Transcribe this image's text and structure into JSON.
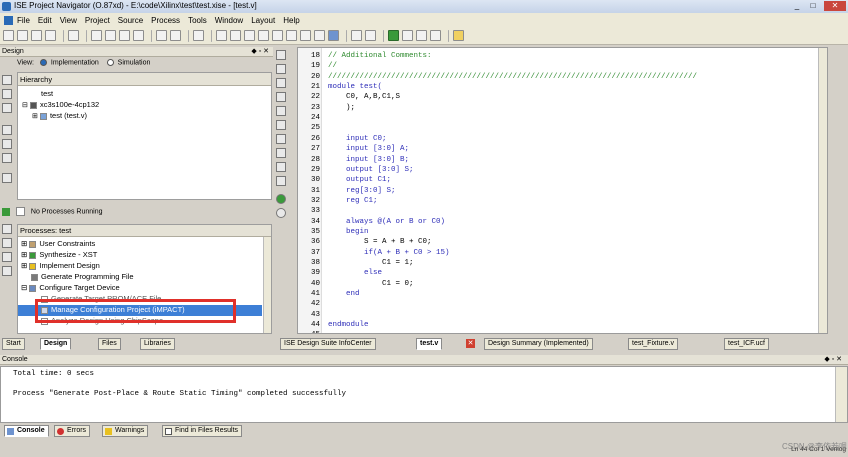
{
  "window": {
    "title": "ISE Project Navigator (O.87xd) - E:\\code\\Xilinx\\test\\test.xise - [test.v]",
    "min": "_",
    "max": "□",
    "close": "✕"
  },
  "menu": [
    "File",
    "Edit",
    "View",
    "Project",
    "Source",
    "Process",
    "Tools",
    "Window",
    "Layout",
    "Help"
  ],
  "design_panel": {
    "title": "Design",
    "view_label": "View:",
    "impl_label": "Implementation",
    "sim_label": "Simulation",
    "hierarchy_title": "Hierarchy",
    "tree": [
      "test",
      "xc3s100e-4cp132",
      "test (test.v)"
    ],
    "no_processes": "No Processes Running",
    "processes_title": "Processes: test",
    "processes": [
      "User Constraints",
      "Synthesize - XST",
      "Implement Design",
      "Generate Programming File",
      "Configure Target Device",
      "Generate Target PROM/ACE File",
      "Manage Configuration Project (iMPACT)",
      "Analyze Design Using ChipScope"
    ],
    "tabs": [
      "Start",
      "Design",
      "Files",
      "Libraries"
    ]
  },
  "editor": {
    "lines": [
      {
        "n": "18",
        "t": "// Additional Comments:"
      },
      {
        "n": "19",
        "t": "//"
      },
      {
        "n": "20",
        "t": "//////////////////////////////////////////////////////////////////////////////////"
      },
      {
        "n": "21",
        "t": "module test("
      },
      {
        "n": "22",
        "t": "    C0, A,B,C1,S"
      },
      {
        "n": "23",
        "t": "    );"
      },
      {
        "n": "24",
        "t": ""
      },
      {
        "n": "25",
        "t": ""
      },
      {
        "n": "26",
        "t": "    input C0;"
      },
      {
        "n": "27",
        "t": "    input [3:0] A;"
      },
      {
        "n": "28",
        "t": "    input [3:0] B;"
      },
      {
        "n": "29",
        "t": "    output [3:0] S;"
      },
      {
        "n": "30",
        "t": "    output C1;"
      },
      {
        "n": "31",
        "t": "    reg[3:0] S;"
      },
      {
        "n": "32",
        "t": "    reg C1;"
      },
      {
        "n": "33",
        "t": ""
      },
      {
        "n": "34",
        "t": "    always @(A or B or C0)"
      },
      {
        "n": "35",
        "t": "    begin"
      },
      {
        "n": "36",
        "t": "        S = A + B + C0;"
      },
      {
        "n": "37",
        "t": "        if(A + B + C0 > 15)"
      },
      {
        "n": "38",
        "t": "            C1 = 1;"
      },
      {
        "n": "39",
        "t": "        else"
      },
      {
        "n": "40",
        "t": "            C1 = 0;"
      },
      {
        "n": "41",
        "t": "    end"
      },
      {
        "n": "42",
        "t": ""
      },
      {
        "n": "43",
        "t": ""
      },
      {
        "n": "44",
        "t": "endmodule"
      },
      {
        "n": "45",
        "t": ""
      }
    ],
    "tabs": [
      "ISE Design Suite InfoCenter",
      "test.v",
      "Design Summary (Implemented)",
      "test_Fixture.v",
      "test_ICF.ucf"
    ]
  },
  "console": {
    "title": "Console",
    "lines": [
      "Total time: 0 secs",
      "",
      "Process \"Generate Post-Place & Route Static Timing\" completed successfully"
    ],
    "tabs": [
      "Console",
      "Errors",
      "Warnings",
      "Find in Files Results"
    ]
  },
  "watermark": "CSDN @李依若嗯",
  "status": "Ln 44 Col 1  Verilog",
  "colors": {
    "highlight": "#3d7fd6",
    "annotation_box": "#e0302a",
    "keyword": "#2e2eb8",
    "comment": "#2f8a2f"
  }
}
